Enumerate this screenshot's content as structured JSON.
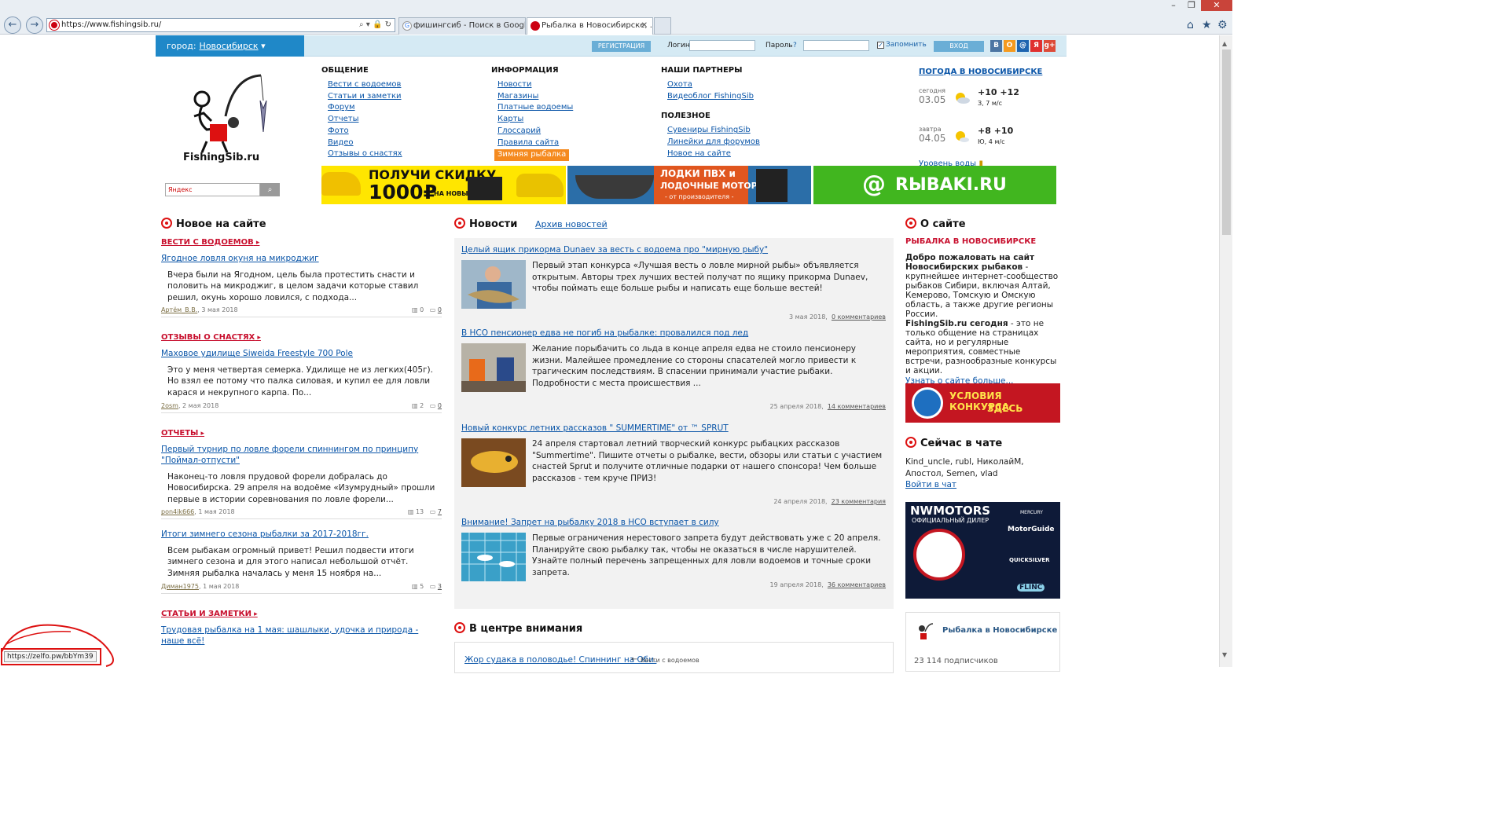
{
  "browser": {
    "url": "https://www.fishingsib.ru/",
    "tabs": [
      {
        "label": "фишингсиб - Поиск в Google",
        "active": false
      },
      {
        "label": "Рыбалка в Новосибирске, ...",
        "active": true
      }
    ],
    "status_url": "https://zelfo.pw/bbYm39"
  },
  "topbar": {
    "city_label": "город:",
    "city_value": "Новосибирск",
    "register": "РЕГИСТРАЦИЯ",
    "login_label": "Логин",
    "password_label": "Пароль",
    "remember": "Запомнить",
    "login_button": "ВХОД",
    "social": [
      "vk",
      "ok",
      "mail",
      "@",
      "я",
      "g+"
    ]
  },
  "header": {
    "logo_text": "FishingSib.ru",
    "search_placeholder": "Яндекс",
    "columns": [
      {
        "title": "ОБЩЕНИЕ",
        "links": [
          "Вести с водоемов",
          "Статьи и заметки",
          "Форум",
          "Отчеты",
          "Фото",
          "Видео",
          "Отзывы о снастях"
        ]
      },
      {
        "title": "ИНФОРМАЦИЯ",
        "links": [
          "Новости",
          "Магазины",
          "Платные водоемы",
          "Карты",
          "Глоссарий",
          "Правила сайта"
        ],
        "highlight": "Зимняя рыбалка"
      },
      {
        "title": "НАШИ ПАРТНЕРЫ",
        "links": [
          "Охота",
          "Видеоблог FishingSib"
        ],
        "title2": "ПОЛЕЗНОЕ",
        "links2": [
          "Сувениры FishingSib",
          "Линейки для форумов",
          "Новое на сайте"
        ]
      }
    ],
    "weather": {
      "title": "ПОГОДА В НОВОСИБИРСКЕ",
      "days": [
        {
          "label": "сегодня",
          "date": "03.05",
          "temp": "+10 +12",
          "wind": "З, 7 м/с"
        },
        {
          "label": "завтра",
          "date": "04.05",
          "temp": "+8 +10",
          "wind": "Ю, 4 м/с"
        }
      ],
      "water_level": "Уровень воды"
    }
  },
  "banners": {
    "b1_line1": "ПОЛУЧИ СКИДКУ",
    "b1_line2": "1000₽",
    "b1_line3": "НА НОВЫЙ",
    "b2_line1": "ЛОДКИ ПВХ и",
    "b2_line2": "ЛОДОЧНЫЕ МОТОРЫ",
    "b2_line3": "- от производителя -",
    "b3_text": "RЫBAKI.RU"
  },
  "new_on_site": {
    "title": "Новое на сайте",
    "items": [
      {
        "category": "ВЕСТИ С ВОДОЕМОВ",
        "title": "Ягодное ловля окуня на микроджиг",
        "text": "Вчера были на Ягодном, цель была протестить снасти и половить на микроджиг, в целом задачи которые ставил решил, окунь хорошо ловился, с подхода...",
        "author": "Артём_В.В.",
        "date": ", 3 мая 2018",
        "views": "0",
        "comments": "0"
      },
      {
        "category": "ОТЗЫВЫ О СНАСТЯХ",
        "title": "Маховое удилище Siweida Freestyle 700 Pole",
        "text": "Это у меня четвертая семерка. Удилище не из легких(405г). Но взял ее потому что палка силовая, и купил ее для ловли карася и некрупного карпа. По...",
        "author": "2osm",
        "date": ", 2 мая 2018",
        "views": "2",
        "comments": "0"
      },
      {
        "category": "ОТЧЕТЫ",
        "title": "Первый турнир по ловле форели спиннингом по принципу \"Поймал-отпусти\"",
        "text": "Наконец-то ловля прудовой форели добралась до Новосибирска. 29 апреля на водоёме «Изумрудный» прошли первые в истории соревнования по ловле форели...",
        "author": "pon4ik666",
        "date": ", 1 мая 2018",
        "views": "13",
        "comments": "7"
      },
      {
        "category": "",
        "title": "Итоги зимнего сезона рыбалки за 2017-2018гг.",
        "text": "Всем рыбакам огромный привет! Решил подвести итоги зимнего сезона и для этого написал небольшой отчёт. Зимняя рыбалка началась у меня 15 ноября на...",
        "author": "Диман1975",
        "date": ", 1 мая 2018",
        "views": "5",
        "comments": "3"
      },
      {
        "category": "СТАТЬИ И ЗАМЕТКИ",
        "title": "Трудовая рыбалка на 1 мая: шашлыки, удочка и природа - наше всё!",
        "text": "",
        "author": "",
        "date": "",
        "views": "",
        "comments": ""
      }
    ]
  },
  "news": {
    "title": "Новости",
    "archive": "Архив новостей",
    "items": [
      {
        "title": "Целый ящик прикорма Dunaev за весть с водоема про \"мирную рыбу\"",
        "text": "Первый этап конкурса «Лучшая весть о ловле мирной рыбы» объявляется открытым. Авторы трех лучших вестей получат по ящику прикорма Dunaev, чтобы поймать еще больше рыбы и написать еще больше вестей!",
        "date": "3 мая 2018,",
        "comments": "0 комментариев"
      },
      {
        "title": "В НСО пенсионер едва не погиб на рыбалке: провалился под лед",
        "text": "Желание порыбачить со льда в конце апреля едва не стоило пенсионеру жизни. Малейшее промедление со стороны спасателей могло привести к трагическим последствиям. В спасении принимали участие рыбаки. Подробности с места происшествия ...",
        "date": "25 апреля 2018,",
        "comments": "14 комментариев"
      },
      {
        "title": "Новый конкурс летних рассказов \" SUMMERTIME\" от ™ SPRUT",
        "text": "24 апреля стартовал летний творческий конкурс рыбацких рассказов \"Summertime\". Пишите отчеты о рыбалке, вести, обзоры или статьи с участием снастей Sprut и получите отличные подарки от нашего спонсора! Чем больше рассказов - тем круче ПРИЗ!",
        "date": "24 апреля 2018,",
        "comments": "23 комментария"
      },
      {
        "title": "Внимание! Запрет на рыбалку 2018 в НСО вступает в силу",
        "text": "Первые ограничения нерестового запрета будут действовать уже с 20 апреля. Планируйте свою рыбалку так, чтобы не оказаться в числе нарушителей. Узнайте полный перечень запрещенных для ловли водоемов и точные сроки запрета.",
        "date": "19 апреля 2018,",
        "comments": "36 комментариев"
      }
    ]
  },
  "focus": {
    "title": "В центре внимания",
    "link": "Жор судака в половодье! Спиннинг на Оби.",
    "category": "Вести с водоемов"
  },
  "about": {
    "title": "О сайте",
    "heading": "РЫБАЛКА В НОВОСИБИРСКЕ",
    "bold1": "Добро пожаловать на сайт Новосибирских рыбаков",
    "text1": " - крупнейшее интернет-сообщество рыбаков Сибири, включая Алтай, Кемерово, Томскую и Омскую область, а также другие регионы России.",
    "bold2": "FishingSib.ru сегодня",
    "text2": " - это не только общение на страницах сайта, но и регулярные мероприятия, совместные встречи, разнообразные конкурсы и акции.",
    "more": "Узнать о сайте больше...",
    "konkurs_line1": "УСЛОВИЯ КОНКУРСА",
    "konkurs_line2": "ЗДЕСЬ"
  },
  "chat": {
    "title": "Сейчас в чате",
    "users": "Kind_uncle, rubl, НиколайМ, Апостол, Semen, vlad",
    "enter": "Войти в чат"
  },
  "nwmotors": {
    "brand": "NWMOTORS",
    "subtitle": "ОФИЦИАЛЬНЫЙ ДИЛЕР",
    "p1": "MERCURY",
    "p2": "MotorGuide",
    "p3": "QUICKSILVER",
    "p4": "FLINC"
  },
  "vk_widget": {
    "name": "Рыбалка в Новосибирске",
    "subscribers": "23 114 подписчиков"
  }
}
